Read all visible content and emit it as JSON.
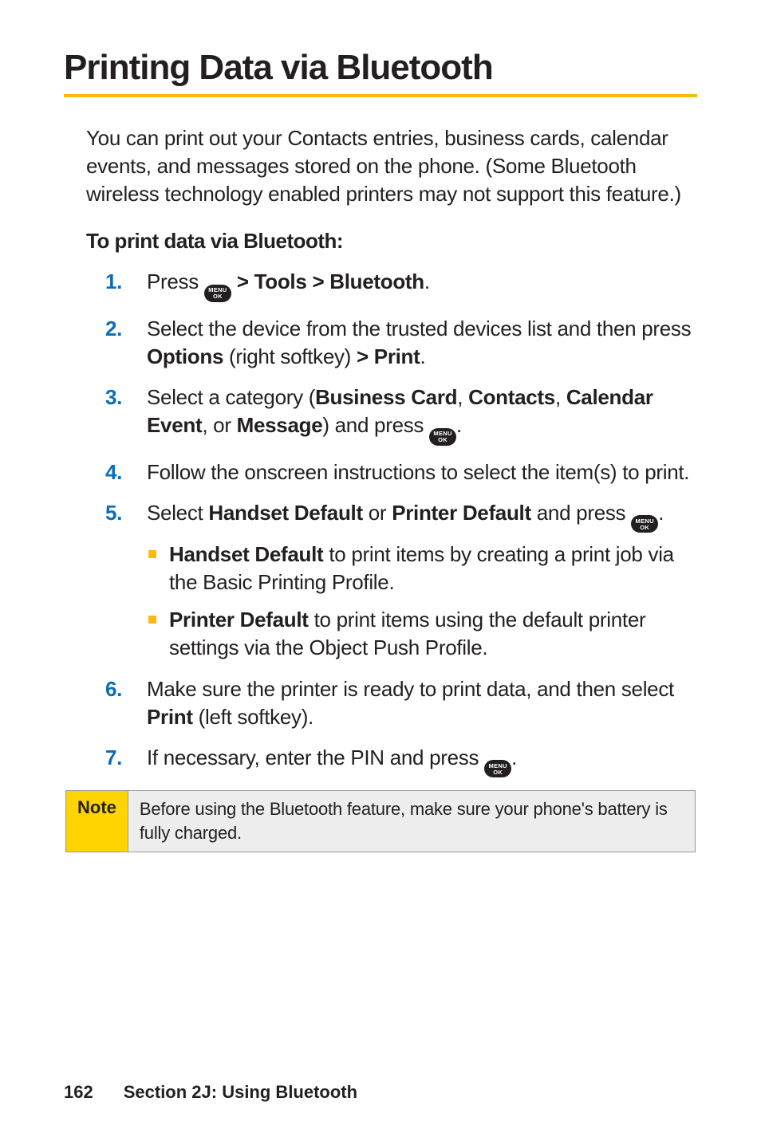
{
  "title": "Printing Data via Bluetooth",
  "intro": "You can print out your Contacts entries, business cards, calendar events, and messages stored on the phone. (Some Bluetooth wireless technology enabled printers may not support this feature.)",
  "subhead": "To print data via Bluetooth:",
  "icon": {
    "line1": "MENU",
    "line2": "OK"
  },
  "steps": {
    "s1": {
      "pre": "Press ",
      "post": " > Tools > Bluetooth",
      "end": "."
    },
    "s2": {
      "t1": "Select the device from the trusted devices list and then press ",
      "b1": "Options",
      "t2": " (right softkey) ",
      "b2": "> Print",
      "t3": "."
    },
    "s3": {
      "t1": "Select a category (",
      "b1": "Business Card",
      "t2": ", ",
      "b2": "Contacts",
      "t3": ", ",
      "b3": "Calendar Event",
      "t4": ", or ",
      "b4": "Message",
      "t5": ") and press ",
      "t6": "."
    },
    "s4": "Follow the onscreen instructions to select the item(s) to print.",
    "s5": {
      "t1": "Select ",
      "b1": "Handset Default",
      "t2": " or ",
      "b2": "Printer Default",
      "t3": " and press ",
      "t4": ".",
      "sub": {
        "a": {
          "b": "Handset Default",
          "t": " to print items by creating a print job via the Basic Printing Profile."
        },
        "b": {
          "b": "Printer Default",
          "t": " to print items using the default printer settings via the Object Push Profile."
        }
      }
    },
    "s6": {
      "t1": "Make sure the printer is ready to print data, and then select ",
      "b1": "Print",
      "t2": " (left softkey)."
    },
    "s7": {
      "t1": "If necessary, enter the PIN and press ",
      "t2": "."
    }
  },
  "note": {
    "label": "Note",
    "body": "Before using the Bluetooth feature, make sure your phone's battery is fully charged."
  },
  "footer": {
    "page": "162",
    "section": "Section 2J: Using Bluetooth"
  }
}
